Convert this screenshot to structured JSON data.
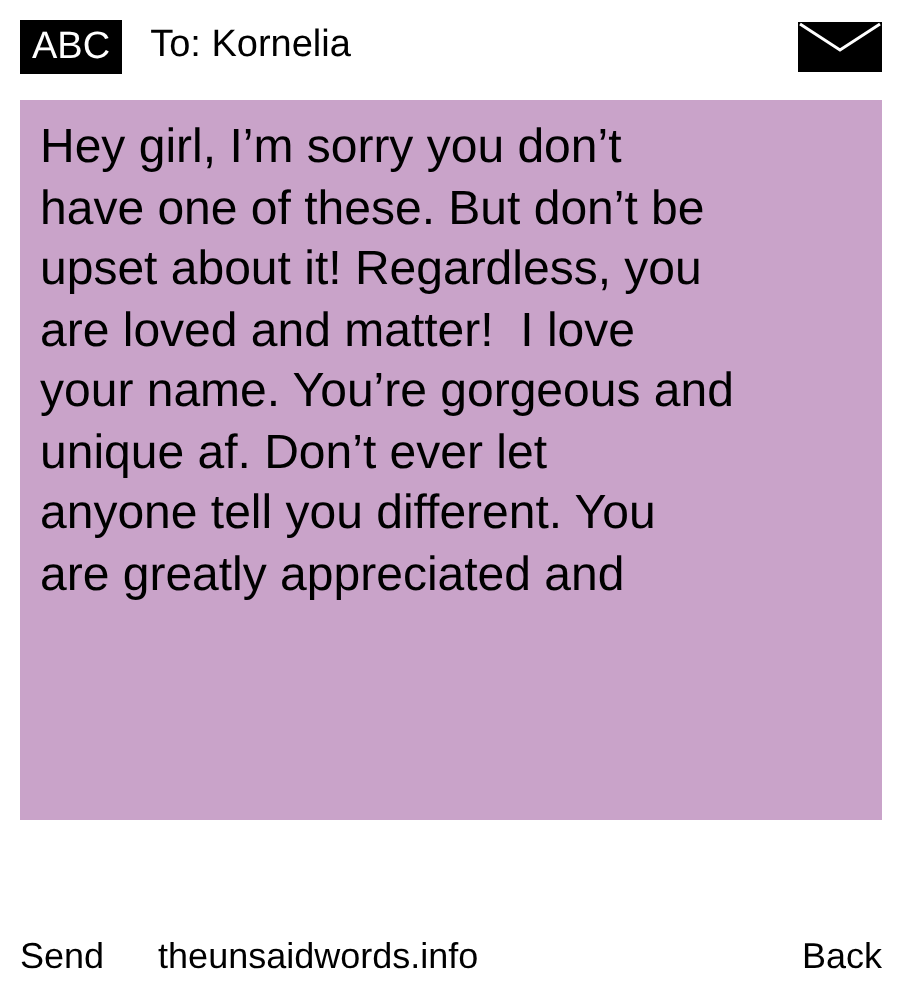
{
  "header": {
    "mode": "ABC",
    "recipient": "To: Kornelia"
  },
  "message": {
    "lines": [
      "Hey girl, I’m sorry you don’t",
      "have one of these. But don’t be",
      "upset about it! Regardless, you",
      "are loved and matter!  I love",
      "your name. You’re gorgeous and",
      "unique af. Don’t ever let",
      "anyone tell you different. You",
      "are greatly appreciated and"
    ]
  },
  "footer": {
    "left": "Send",
    "center": "theunsaidwords.info",
    "right": "Back"
  }
}
